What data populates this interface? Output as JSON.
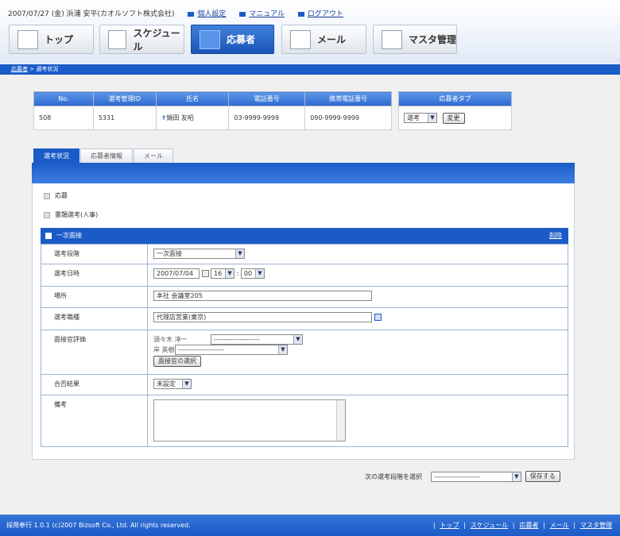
{
  "header": {
    "date_user": "2007/07/27 (金) 浜浦 安平(カオルソフト株式会社)",
    "links": [
      "個人設定",
      "マニュアル",
      "ログアウト"
    ]
  },
  "nav": [
    {
      "label": "トップ",
      "icon": "org-chart-icon"
    },
    {
      "label": "スケジュール",
      "icon": "calendar-icon"
    },
    {
      "label": "応募者",
      "icon": "people-icon",
      "active": true
    },
    {
      "label": "メール",
      "icon": "envelope-icon"
    },
    {
      "label": "マスタ管理",
      "icon": "tools-icon"
    }
  ],
  "breadcrumb": {
    "item1": "応募者",
    "sep": ">",
    "item2": "選考状況"
  },
  "applicant": {
    "headers": [
      "No.",
      "選考管理ID",
      "氏名",
      "電話番号",
      "携帯電話番号"
    ],
    "no": "508",
    "id": "5331",
    "name": "鍋田 友昭",
    "phone": "03-9999-9999",
    "mobile": "090-9999-9999"
  },
  "type_box": {
    "header": "応募者タブ",
    "select": "選考",
    "button": "変更"
  },
  "tabs": [
    "選考状況",
    "応募者情報",
    "メール"
  ],
  "sections": {
    "collapsed": [
      "応募",
      "書類選考(人事)"
    ],
    "open_title": "一次面接",
    "delete_label": "削除"
  },
  "form": {
    "stage_label": "選考段階",
    "stage_value": "一次面接",
    "date_label": "選考日時",
    "date_value": "2007/07/04",
    "hour": "16",
    "colon": ":",
    "minute": "00",
    "place_label": "場所",
    "place_value": "本社 会議室205",
    "job_label": "選考職種",
    "job_value": "代理店営業(東京)",
    "eval_label": "面接官評価",
    "interviewers": [
      {
        "name": "須々木 淳一",
        "value": "--------------------"
      },
      {
        "name": "岸 英樹",
        "value": "--------------------"
      }
    ],
    "choose_button": "面接官の選択",
    "result_label": "合否結果",
    "result_value": "未設定",
    "note_label": "備考",
    "note_value": ""
  },
  "next": {
    "label": "次の選考段階を選択",
    "value": "--------------------",
    "save": "保存する"
  },
  "footer": {
    "copyright": "採用奉行 1.0.1 (c)2007 Bizsoft Co., Ltd. All rights reserved.",
    "links": [
      "トップ",
      "スケジュール",
      "応募者",
      "メール",
      "マスタ管理"
    ]
  }
}
